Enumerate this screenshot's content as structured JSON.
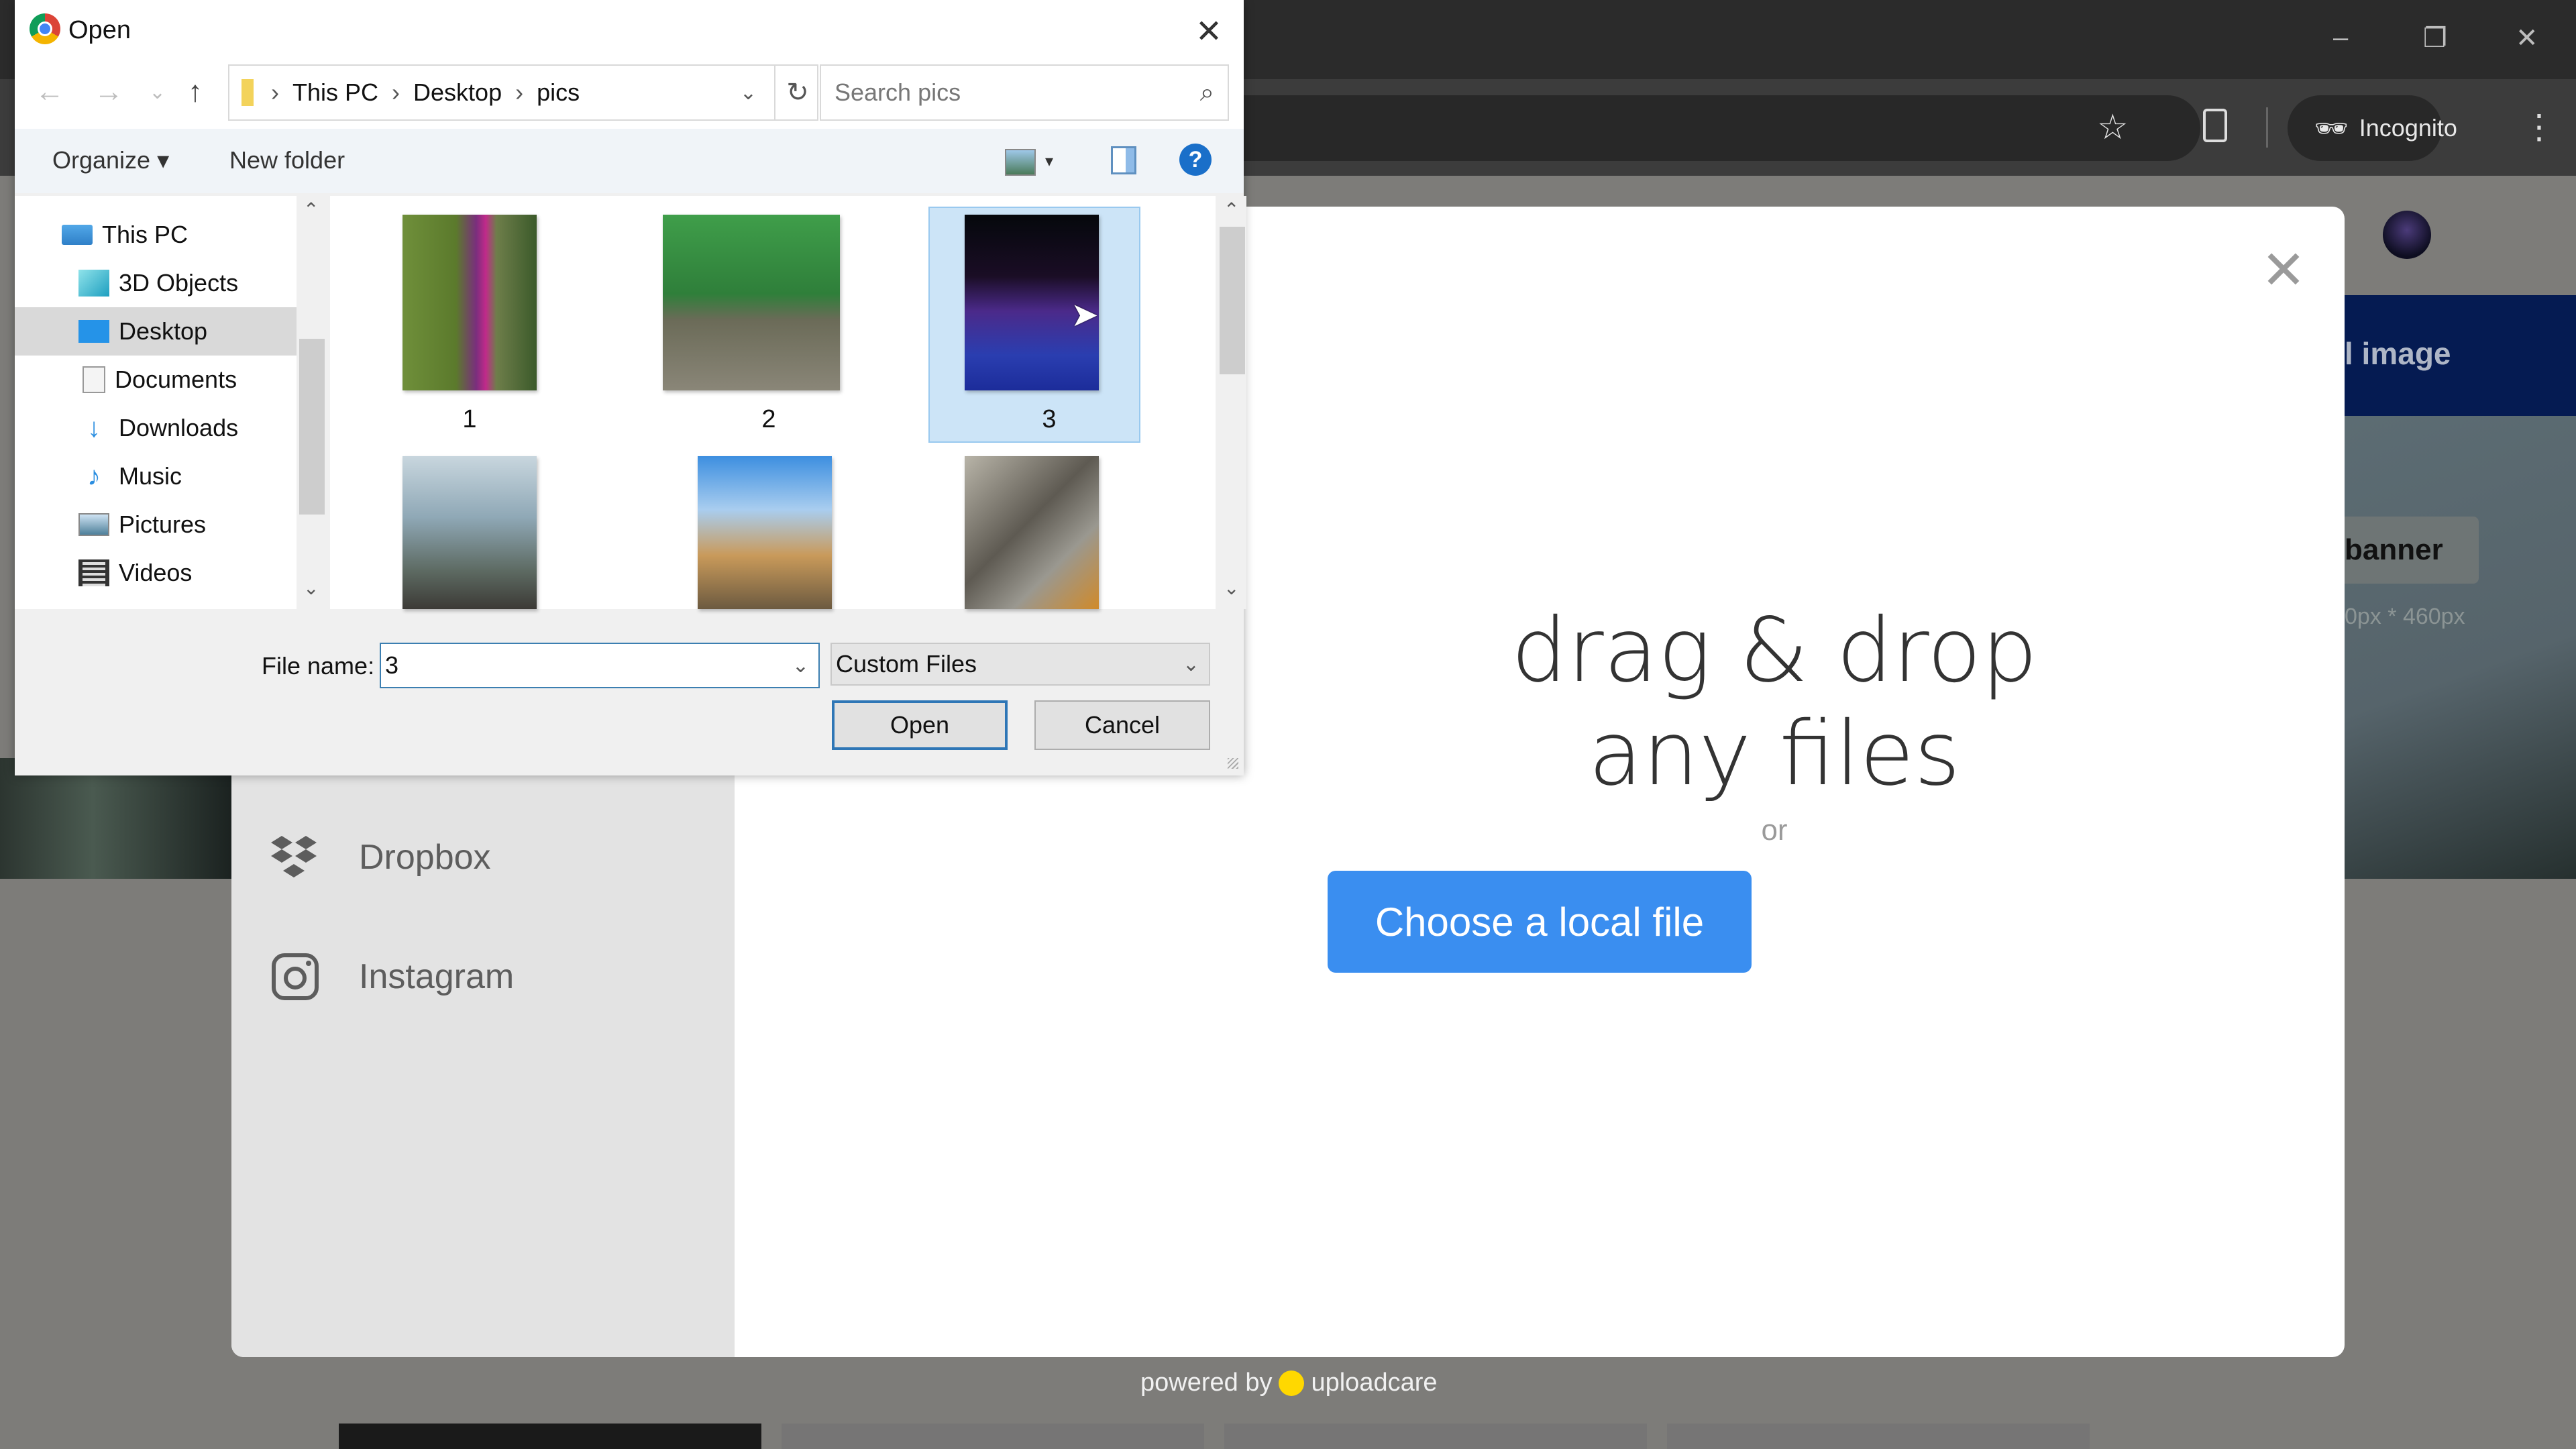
{
  "browser": {
    "window_controls": {
      "minimize": "–",
      "restore": "❐",
      "close": "✕"
    },
    "toolbar": {
      "incognito_label": "Incognito",
      "menu_icon": "⋮",
      "star_icon": "☆",
      "extensions_icon": "puzzle"
    }
  },
  "page": {
    "header_partial": "l image",
    "banner_partial": "banner",
    "dims_partial": "0px * 460px"
  },
  "uploadcare": {
    "services": [
      {
        "label": "Dropbox",
        "icon": "dropbox-icon"
      },
      {
        "label": "Instagram",
        "icon": "instagram-icon"
      }
    ],
    "drag_line1": "drag & drop",
    "drag_line2": "any files",
    "or_text": "or",
    "choose_button": "Choose a local file",
    "powered_by": "powered by",
    "brand": "uploadcare",
    "close_icon": "✕",
    "brand_color": "#ffd800",
    "button_color": "#3a8ef0"
  },
  "dialog": {
    "title": "Open",
    "close_icon": "✕",
    "nav": {
      "back": "←",
      "forward": "→",
      "recent": "⌄",
      "up": "↑"
    },
    "breadcrumb": [
      "This PC",
      "Desktop",
      "pics"
    ],
    "refresh_icon": "↻",
    "search_placeholder": "Search pics",
    "organize_label": "Organize ▾",
    "new_folder_label": "New folder",
    "help_icon": "?",
    "tree": [
      {
        "label": "This PC",
        "icon": "this-pc-icon"
      },
      {
        "label": "3D Objects",
        "icon": "3d-objects-icon"
      },
      {
        "label": "Desktop",
        "icon": "desktop-icon",
        "selected": true
      },
      {
        "label": "Documents",
        "icon": "documents-icon"
      },
      {
        "label": "Downloads",
        "icon": "downloads-icon"
      },
      {
        "label": "Music",
        "icon": "music-icon"
      },
      {
        "label": "Pictures",
        "icon": "pictures-icon"
      },
      {
        "label": "Videos",
        "icon": "videos-icon"
      }
    ],
    "files": [
      {
        "name": "1",
        "selected": false
      },
      {
        "name": "2",
        "selected": false
      },
      {
        "name": "3",
        "selected": true
      },
      {
        "name": "",
        "selected": false
      },
      {
        "name": "",
        "selected": false
      },
      {
        "name": "",
        "selected": false
      }
    ],
    "file_name_label": "File name:",
    "file_name_value": "3",
    "file_type_value": "Custom Files",
    "open_button": "Open",
    "cancel_button": "Cancel"
  }
}
